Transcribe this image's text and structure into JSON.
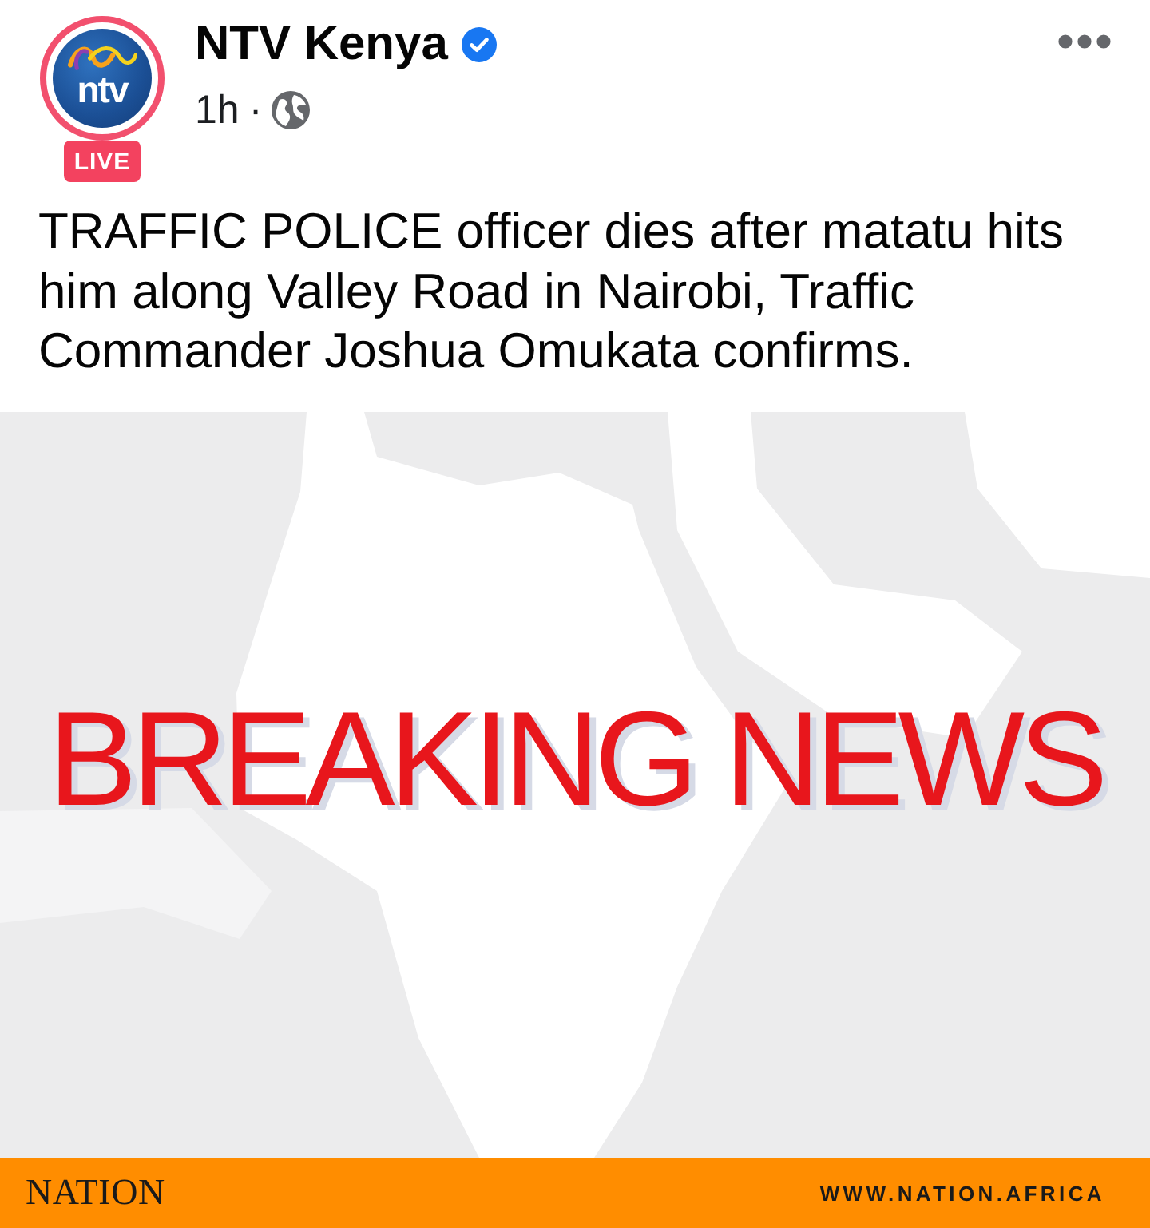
{
  "post": {
    "author": {
      "name": "NTV Kenya",
      "verified": true,
      "avatar": {
        "logo_text": "ntv",
        "live": true,
        "live_badge": "LIVE"
      }
    },
    "time": "1h",
    "separator": "·",
    "text_lines": [
      "TRAFFIC POLICE officer dies after matatu hits",
      "him along Valley Road in Nairobi, Traffic",
      "Commander Joshua Omukata confirms."
    ],
    "image": {
      "headline": "BREAKING NEWS",
      "footer_brand": "NATION",
      "footer_url": "WWW.NATION.AFRICA"
    }
  }
}
